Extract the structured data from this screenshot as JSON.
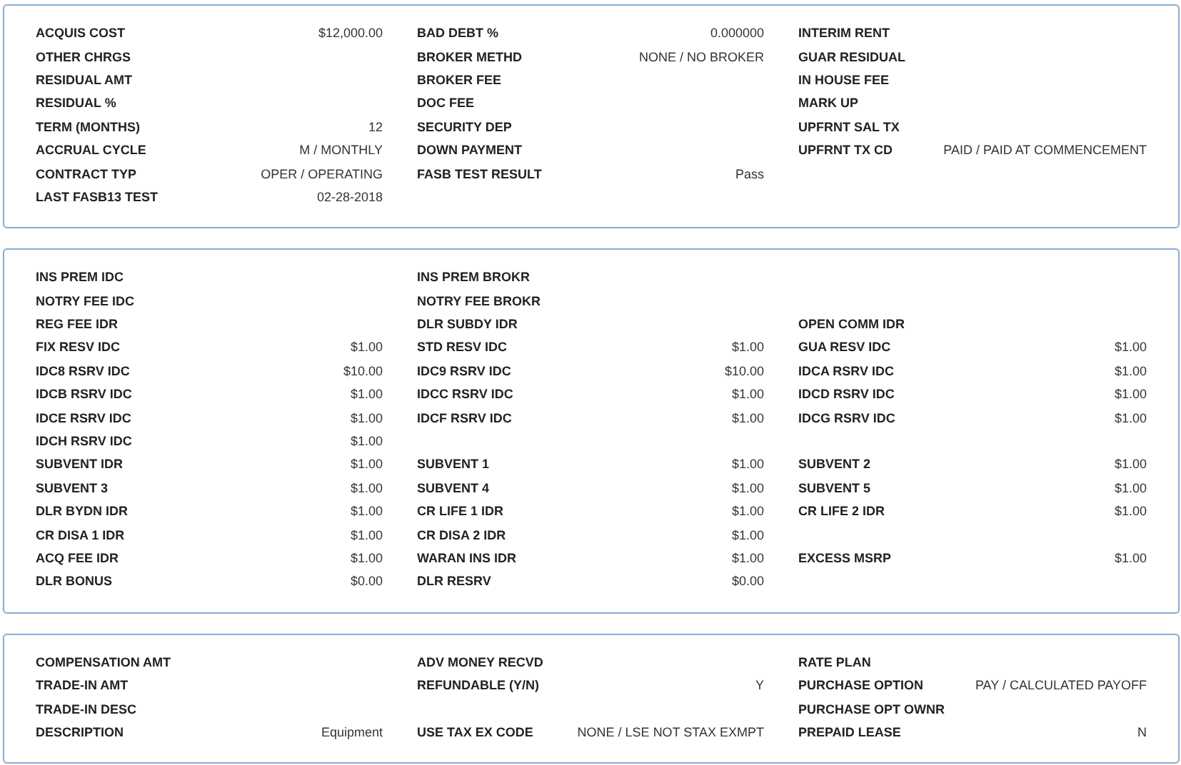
{
  "panels": [
    {
      "rows": [
        [
          {
            "label": "ACQUIS COST",
            "value": "$12,000.00"
          },
          {
            "label": "BAD DEBT %",
            "value": "0.000000"
          },
          {
            "label": "INTERIM RENT"
          }
        ],
        [
          {
            "label": "OTHER CHRGS"
          },
          {
            "label": "BROKER METHD",
            "value": "NONE / NO BROKER"
          },
          {
            "label": "GUAR RESIDUAL"
          }
        ],
        [
          {
            "label": "RESIDUAL AMT"
          },
          {
            "label": "BROKER FEE"
          },
          {
            "label": "IN HOUSE FEE"
          }
        ],
        [
          {
            "label": "RESIDUAL %"
          },
          {
            "label": "DOC FEE"
          },
          {
            "label": "MARK UP"
          }
        ],
        [
          {
            "label": "TERM (MONTHS)",
            "value": "12"
          },
          {
            "label": "SECURITY DEP"
          },
          {
            "label": "UPFRNT SAL TX"
          }
        ],
        [
          {
            "label": "ACCRUAL CYCLE",
            "value": "M / MONTHLY"
          },
          {
            "label": "DOWN PAYMENT"
          },
          {
            "label": "UPFRNT TX CD",
            "value": "PAID / PAID AT COMMENCEMENT"
          }
        ],
        [
          {
            "label": "CONTRACT TYP",
            "value": "OPER / OPERATING"
          },
          {
            "label": "FASB TEST RESULT",
            "value": "Pass"
          },
          null
        ],
        [
          {
            "label": "LAST FASB13 TEST",
            "value": "02-28-2018"
          },
          null,
          null
        ]
      ]
    },
    {
      "rows": [
        [
          {
            "label": "INS PREM IDC"
          },
          {
            "label": "INS PREM BROKR"
          },
          null
        ],
        [
          {
            "label": "NOTRY FEE IDC"
          },
          {
            "label": "NOTRY FEE BROKR"
          },
          null
        ],
        [
          {
            "label": "REG FEE IDR"
          },
          {
            "label": "DLR SUBDY IDR"
          },
          {
            "label": "OPEN COMM IDR"
          }
        ],
        [
          {
            "label": "FIX RESV IDC",
            "value": "$1.00"
          },
          {
            "label": "STD RESV IDC",
            "value": "$1.00"
          },
          {
            "label": "GUA RESV IDC",
            "value": "$1.00"
          }
        ],
        [
          {
            "label": "IDC8 RSRV IDC",
            "value": "$10.00"
          },
          {
            "label": "IDC9 RSRV IDC",
            "value": "$10.00"
          },
          {
            "label": "IDCA RSRV IDC",
            "value": "$1.00"
          }
        ],
        [
          {
            "label": "IDCB RSRV IDC",
            "value": "$1.00"
          },
          {
            "label": "IDCC RSRV IDC",
            "value": "$1.00"
          },
          {
            "label": "IDCD RSRV IDC",
            "value": "$1.00"
          }
        ],
        [
          {
            "label": "IDCE RSRV IDC",
            "value": "$1.00"
          },
          {
            "label": "IDCF RSRV IDC",
            "value": "$1.00"
          },
          {
            "label": "IDCG RSRV IDC",
            "value": "$1.00"
          }
        ],
        [
          {
            "label": "IDCH RSRV IDC",
            "value": "$1.00"
          },
          null,
          null
        ],
        [
          {
            "label": "SUBVENT IDR",
            "value": "$1.00"
          },
          {
            "label": "SUBVENT 1",
            "value": "$1.00"
          },
          {
            "label": "SUBVENT 2",
            "value": "$1.00"
          }
        ],
        [
          {
            "label": "SUBVENT 3",
            "value": "$1.00"
          },
          {
            "label": "SUBVENT 4",
            "value": "$1.00"
          },
          {
            "label": "SUBVENT 5",
            "value": "$1.00"
          }
        ],
        [
          {
            "label": "DLR BYDN IDR",
            "value": "$1.00"
          },
          {
            "label": "CR LIFE 1 IDR",
            "value": "$1.00"
          },
          {
            "label": "CR LIFE 2 IDR",
            "value": "$1.00"
          }
        ],
        [
          {
            "label": "CR DISA 1 IDR",
            "value": "$1.00"
          },
          {
            "label": "CR DISA 2 IDR",
            "value": "$1.00"
          },
          null
        ],
        [
          {
            "label": "ACQ FEE IDR",
            "value": "$1.00"
          },
          {
            "label": "WARAN INS IDR",
            "value": "$1.00"
          },
          {
            "label": "EXCESS MSRP",
            "value": "$1.00"
          }
        ],
        [
          {
            "label": "DLR BONUS",
            "value": "$0.00"
          },
          {
            "label": "DLR RESRV",
            "value": "$0.00"
          },
          null
        ]
      ]
    },
    {
      "rows": [
        [
          {
            "label": "COMPENSATION AMT"
          },
          {
            "label": "ADV MONEY RECVD"
          },
          {
            "label": "RATE PLAN"
          }
        ],
        [
          {
            "label": "TRADE-IN AMT"
          },
          {
            "label": "REFUNDABLE (Y/N)",
            "value": "Y"
          },
          {
            "label": "PURCHASE OPTION",
            "value": "PAY / CALCULATED PAYOFF"
          }
        ],
        [
          {
            "label": "TRADE-IN DESC"
          },
          null,
          {
            "label": "PURCHASE OPT OWNR"
          }
        ],
        [
          {
            "label": "DESCRIPTION",
            "value": "Equipment"
          },
          {
            "label": "USE TAX EX CODE",
            "value": "NONE / LSE NOT STAX EXMPT"
          },
          {
            "label": "PREPAID LEASE",
            "value": "N"
          }
        ]
      ]
    }
  ]
}
